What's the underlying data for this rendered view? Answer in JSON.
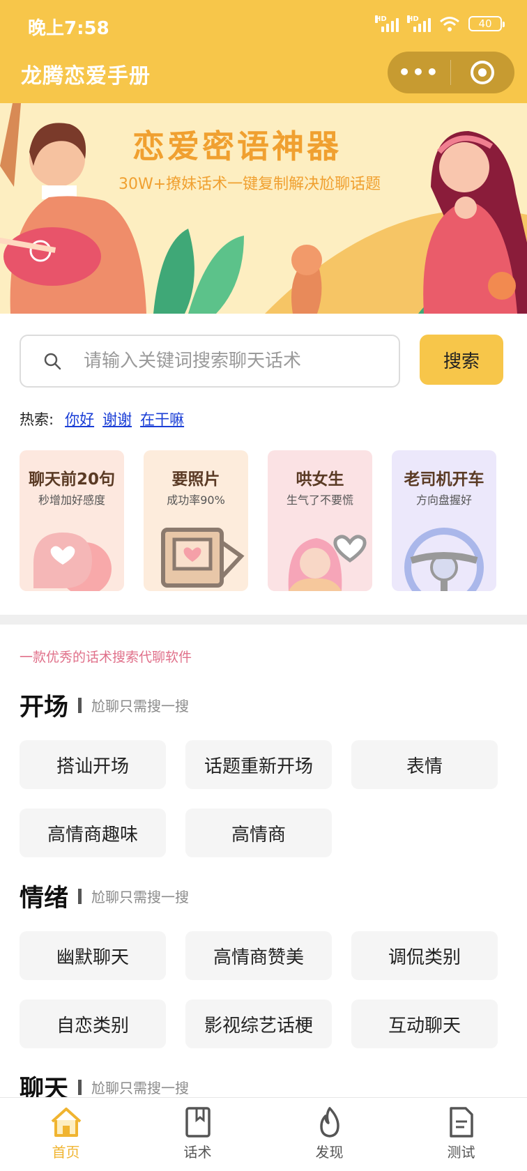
{
  "status_bar": {
    "time": "晚上7:58",
    "battery": "40",
    "network_labels": [
      "HD",
      "HD"
    ]
  },
  "header": {
    "title": "龙腾恋爱手册",
    "more_symbol": "•••"
  },
  "banner": {
    "title": "恋爱密语神器",
    "subtitle": "30W+撩妹话术一键复制解决尬聊话题"
  },
  "search": {
    "placeholder": "请输入关键词搜索聊天话术",
    "value": "",
    "button_label": "搜索"
  },
  "hot": {
    "label": "热索:",
    "items": [
      "你好",
      "谢谢",
      "在干嘛"
    ]
  },
  "cards": [
    {
      "title": "聊天前20句",
      "subtitle": "秒增加好感度",
      "icon": "chat-bubble-heart-icon",
      "bg": "#fde8df"
    },
    {
      "title": "要照片",
      "subtitle": "成功率90%",
      "icon": "photo-frame-heart-icon",
      "bg": "#fdecdc"
    },
    {
      "title": "哄女生",
      "subtitle": "生气了不要慌",
      "icon": "girl-heart-icon",
      "bg": "#fbe2e4"
    },
    {
      "title": "老司机开车",
      "subtitle": "方向盘握好",
      "icon": "steering-wheel-icon",
      "bg": "#ece8fb"
    }
  ],
  "slogan": "一款优秀的话术搜索代聊软件",
  "sections": [
    {
      "title": "开场",
      "subtitle": "尬聊只需搜一搜",
      "tags": [
        "搭讪开场",
        "话题重新开场",
        "表情",
        "高情商趣味",
        "高情商"
      ]
    },
    {
      "title": "情绪",
      "subtitle": "尬聊只需搜一搜",
      "tags": [
        "幽默聊天",
        "高情商赞美",
        "调侃类别",
        "自恋类别",
        "影视综艺话梗",
        "互动聊天"
      ]
    },
    {
      "title": "聊天",
      "subtitle": "尬聊只需搜一搜",
      "tags": []
    }
  ],
  "tabbar": [
    {
      "label": "首页",
      "icon": "home-icon",
      "active": true
    },
    {
      "label": "话术",
      "icon": "bookmark-book-icon",
      "active": false
    },
    {
      "label": "发现",
      "icon": "flame-icon",
      "active": false
    },
    {
      "label": "测试",
      "icon": "document-icon",
      "active": false
    }
  ],
  "colors": {
    "primary": "#f7c64a",
    "active_tab": "#f0b430",
    "link": "#1a3ed6",
    "slogan": "#e0708a"
  }
}
